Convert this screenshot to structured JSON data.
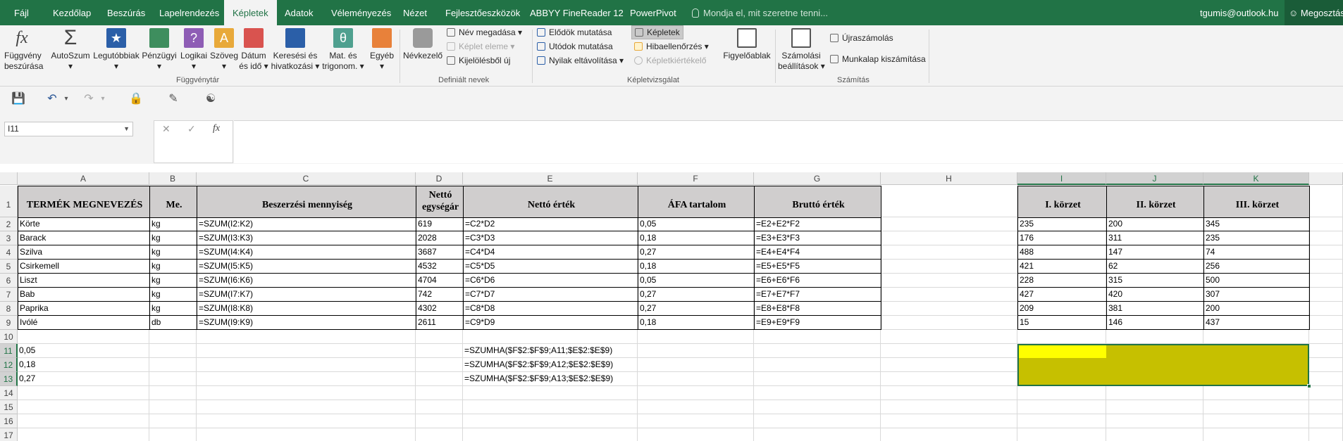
{
  "tabs": [
    "Fájl",
    "Kezdőlap",
    "Beszúrás",
    "Lapelrendezés",
    "Képletek",
    "Adatok",
    "Véleményezés",
    "Nézet",
    "Fejlesztőeszközök",
    "ABBYY FineReader 12",
    "PowerPivot"
  ],
  "active_tab": "Képletek",
  "tell_me": "Mondja el, mit szeretne tenni...",
  "account": "tgumis@outlook.hu",
  "share": "Megosztás",
  "ribbon": {
    "function_insert": [
      "Függvény",
      "beszúrása"
    ],
    "autosum": "AutoSzum",
    "recent": "Legutóbbiak",
    "financial": "Pénzügyi",
    "logical": "Logikai",
    "text": "Szöveg",
    "datetime": [
      "Dátum",
      "és idő"
    ],
    "lookup": [
      "Keresési és",
      "hivatkozási"
    ],
    "math": [
      "Mat. és",
      "trigonom."
    ],
    "other": "Egyéb",
    "group_library": "Függvénytár",
    "name_manager": "Névkezelő",
    "define_name": "Név megadása",
    "use_in_formula": "Képlet eleme",
    "create_from_selection": "Kijelölésből új",
    "group_names": "Definiált nevek",
    "trace_precedents": "Elődök mutatása",
    "trace_dependents": "Utódok mutatása",
    "remove_arrows": "Nyilak eltávolítása",
    "show_formulas": "Képletek",
    "error_checking": "Hibaellenőrzés",
    "evaluate_formula": "Képletkiértékelő",
    "group_auditing": "Képletvizsgálat",
    "watch_window": "Figyelőablak",
    "calc_options": [
      "Számolási",
      "beállítások"
    ],
    "calc_now": "Újraszámolás",
    "calc_sheet": "Munkalap kiszámítása",
    "group_calc": "Számítás"
  },
  "namebox": "I11",
  "columns": [
    "A",
    "B",
    "C",
    "D",
    "E",
    "F",
    "G",
    "H",
    "I",
    "J",
    "K"
  ],
  "headers": {
    "A": "TERMÉK MEGNEVEZÉS",
    "B": "Me.",
    "C": "Beszerzési mennyiség",
    "D": [
      "Nettó",
      "egységár"
    ],
    "E": "Nettó érték",
    "F": "ÁFA tartalom",
    "G": "Bruttó érték",
    "I": "I. körzet",
    "J": "II. körzet",
    "K": "III. körzet"
  },
  "rows": [
    {
      "A": "Körte",
      "B": "kg",
      "C": "=SZUM(I2:K2)",
      "D": "619",
      "E": "=C2*D2",
      "F": "0,05",
      "G": "=E2+E2*F2",
      "I": "235",
      "J": "200",
      "K": "345"
    },
    {
      "A": "Barack",
      "B": "kg",
      "C": "=SZUM(I3:K3)",
      "D": "2028",
      "E": "=C3*D3",
      "F": "0,18",
      "G": "=E3+E3*F3",
      "I": "176",
      "J": "311",
      "K": "235"
    },
    {
      "A": "Szilva",
      "B": "kg",
      "C": "=SZUM(I4:K4)",
      "D": "3687",
      "E": "=C4*D4",
      "F": "0,27",
      "G": "=E4+E4*F4",
      "I": "488",
      "J": "147",
      "K": "74"
    },
    {
      "A": "Csirkemell",
      "B": "kg",
      "C": "=SZUM(I5:K5)",
      "D": "4532",
      "E": "=C5*D5",
      "F": "0,18",
      "G": "=E5+E5*F5",
      "I": "421",
      "J": "62",
      "K": "256"
    },
    {
      "A": "Liszt",
      "B": "kg",
      "C": "=SZUM(I6:K6)",
      "D": "4704",
      "E": "=C6*D6",
      "F": "0,05",
      "G": "=E6+E6*F6",
      "I": "228",
      "J": "315",
      "K": "500"
    },
    {
      "A": "Bab",
      "B": "kg",
      "C": "=SZUM(I7:K7)",
      "D": "742",
      "E": "=C7*D7",
      "F": "0,27",
      "G": "=E7+E7*F7",
      "I": "427",
      "J": "420",
      "K": "307"
    },
    {
      "A": "Paprika",
      "B": "kg",
      "C": "=SZUM(I8:K8)",
      "D": "4302",
      "E": "=C8*D8",
      "F": "0,27",
      "G": "=E8+E8*F8",
      "I": "209",
      "J": "381",
      "K": "200"
    },
    {
      "A": "Ivólé",
      "B": "db",
      "C": "=SZUM(I9:K9)",
      "D": "2611",
      "E": "=C9*D9",
      "F": "0,18",
      "G": "=E9+E9*F9",
      "I": "15",
      "J": "146",
      "K": "437"
    }
  ],
  "summary": [
    {
      "A": "0,05",
      "E": "=SZUMHA($F$2:$F$9;A11;$E$2:$E$9)"
    },
    {
      "A": "0,18",
      "E": "=SZUMHA($F$2:$F$9;A12;$E$2:$E$9)"
    },
    {
      "A": "0,27",
      "E": "=SZUMHA($F$2:$F$9;A13;$E$2:$E$9)"
    }
  ],
  "row_numbers": [
    "1",
    "2",
    "3",
    "4",
    "5",
    "6",
    "7",
    "8",
    "9",
    "10",
    "11",
    "12",
    "13",
    "14",
    "15",
    "16",
    "17"
  ],
  "colors": {
    "accent": "#217346",
    "selection_fill": "#c6c000",
    "active_cell": "#ffff00",
    "header_fill": "#d0cece"
  }
}
